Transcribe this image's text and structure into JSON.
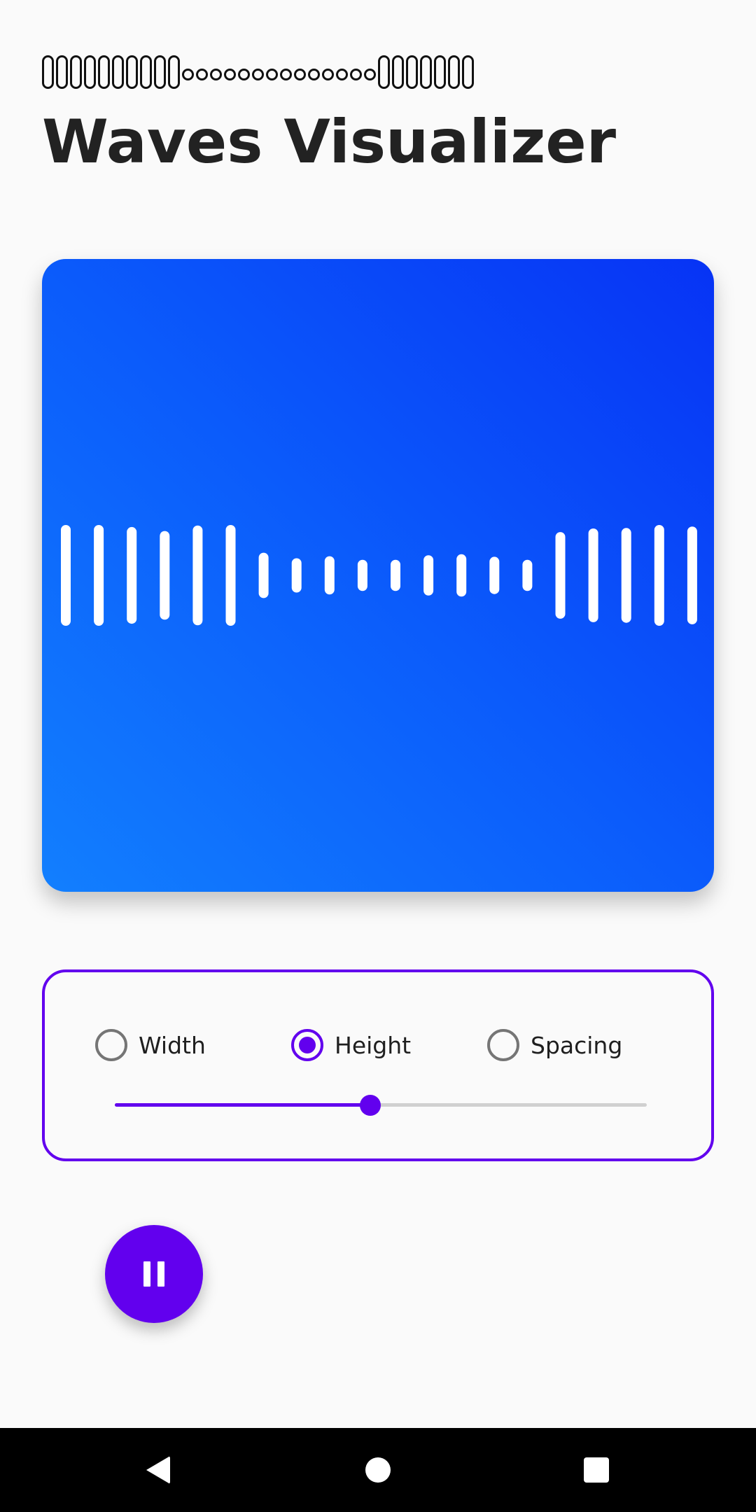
{
  "app": {
    "glyph_header": "0000000000oooooooooooooo0000000",
    "title": "Waves Visualizer"
  },
  "visualizer": {
    "background_gradient": [
      "#127ffe",
      "#0733f5"
    ],
    "bar_color": "#ffffff",
    "bar_heights_relative": [
      1.0,
      1.0,
      0.96,
      0.88,
      0.99,
      1.0,
      0.45,
      0.34,
      0.38,
      0.31,
      0.31,
      0.4,
      0.42,
      0.37,
      0.31,
      0.86,
      0.93,
      0.94,
      1.0,
      0.97
    ]
  },
  "controls": {
    "accent_color": "#6200ee",
    "options": [
      {
        "label": "Width",
        "checked": false
      },
      {
        "label": "Height",
        "checked": true
      },
      {
        "label": "Spacing",
        "checked": false
      }
    ],
    "slider_value": 0.48
  },
  "fab": {
    "icon": "pause-icon",
    "color": "#6200ee"
  },
  "nav_bar": {
    "back_icon": "back-triangle-icon",
    "home_icon": "home-circle-icon",
    "recent_icon": "recents-square-icon"
  }
}
